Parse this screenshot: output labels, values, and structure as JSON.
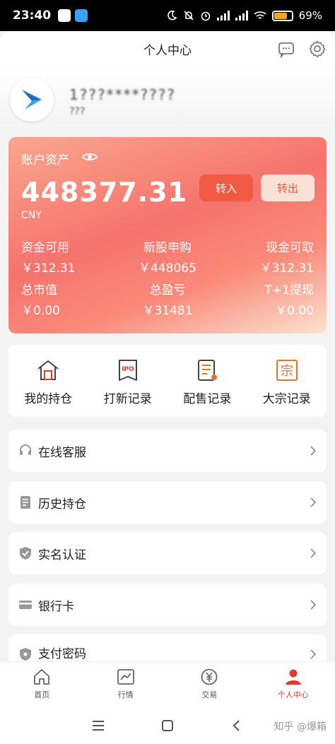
{
  "status_bar": {
    "time": "23:40",
    "battery": "69%",
    "battery_level": 0.69
  },
  "header": {
    "title": "个人中心"
  },
  "profile": {
    "user_id": "1???****????",
    "user_name": "???"
  },
  "asset_card": {
    "label": "账户资产",
    "total": "448377.31",
    "currency": "CNY",
    "transfer_in": "转入",
    "transfer_out": "转出",
    "metrics": [
      {
        "label": "资金可用",
        "value": "￥312.31"
      },
      {
        "label": "新股申购",
        "value": "￥448065"
      },
      {
        "label": "现金可取",
        "value": "￥312.31"
      },
      {
        "label": "总市值",
        "value": "￥0.00"
      },
      {
        "label": "总盈亏",
        "value": "￥31481"
      },
      {
        "label": "T+1提现",
        "value": "￥0.00"
      }
    ]
  },
  "quick_actions": [
    {
      "label": "我的持仓",
      "icon": "holdings-icon"
    },
    {
      "label": "打新记录",
      "icon": "ipo-icon"
    },
    {
      "label": "配售记录",
      "icon": "allotment-icon"
    },
    {
      "label": "大宗记录",
      "icon": "block-trade-icon"
    }
  ],
  "menu": [
    {
      "label": "在线客服",
      "icon": "customer-service-icon"
    },
    {
      "label": "历史持仓",
      "icon": "history-icon"
    },
    {
      "label": "实名认证",
      "icon": "shield-icon"
    },
    {
      "label": "银行卡",
      "icon": "bank-card-icon"
    },
    {
      "label": "支付密码",
      "icon": "password-icon"
    }
  ],
  "bottom_nav": [
    {
      "label": "首页",
      "icon": "home-icon"
    },
    {
      "label": "行情",
      "icon": "chart-icon"
    },
    {
      "label": "交易",
      "icon": "trade-icon"
    },
    {
      "label": "个人中心",
      "icon": "person-icon",
      "active": true
    }
  ],
  "watermark": "知乎 @爆箱",
  "colors": {
    "accent": "#e03a2e",
    "card_start": "#f9a78e",
    "card_end": "#fbe3cf"
  }
}
